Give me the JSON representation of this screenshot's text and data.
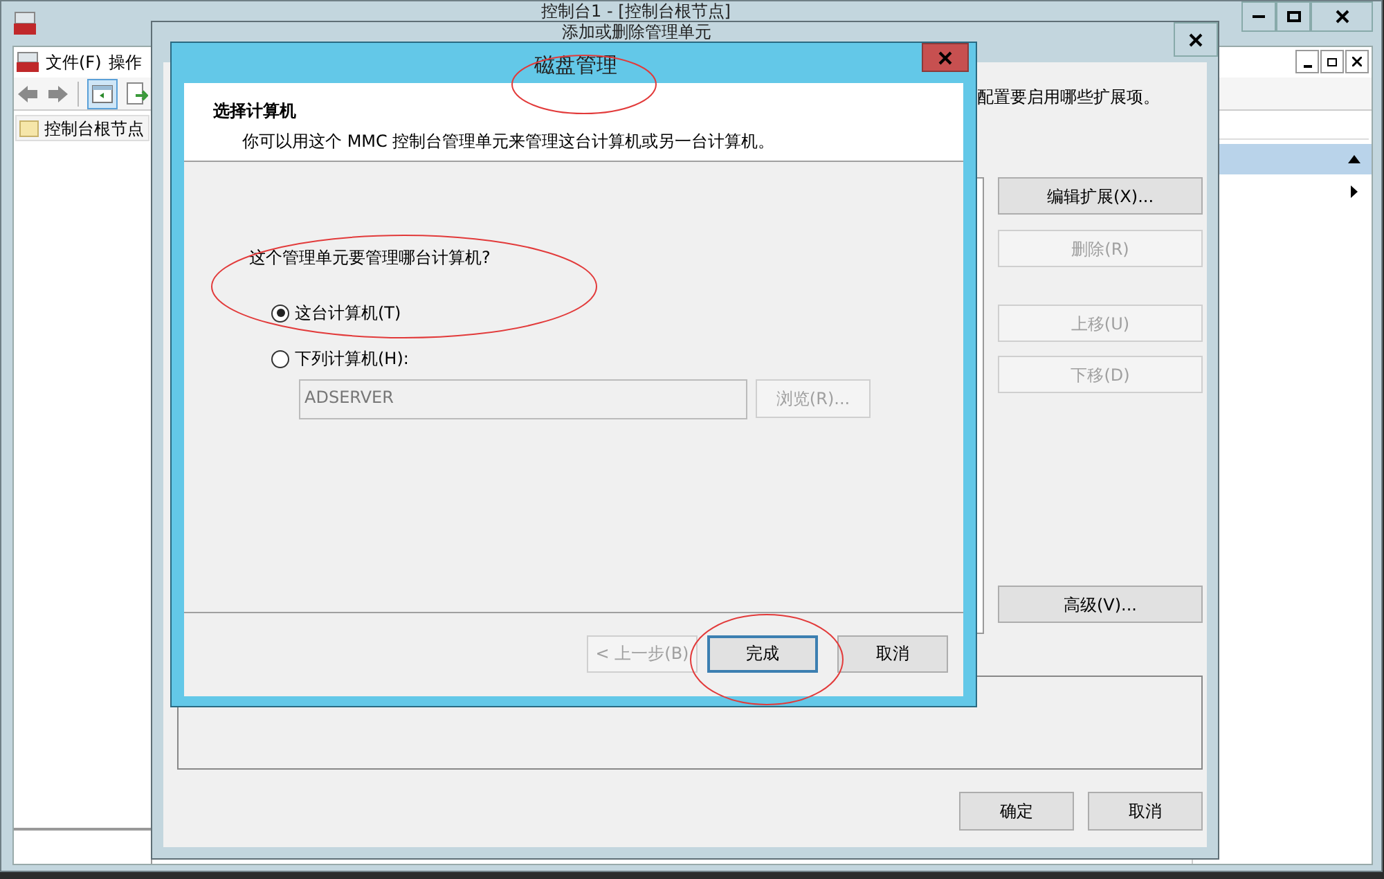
{
  "main_window": {
    "title": "控制台1 - [控制台根节点]",
    "menu": [
      {
        "label": "文件(F)"
      },
      {
        "label": "操作"
      }
    ],
    "tree": {
      "items": [
        {
          "label": "控制台根节点",
          "selected": false
        }
      ]
    }
  },
  "snapin_dialog": {
    "title": "添加或删除管理单元",
    "instruction": "配置要启用哪些扩展项。",
    "side_buttons": [
      {
        "label": "编辑扩展(X)...",
        "disabled": false
      },
      {
        "label": "删除(R)",
        "disabled": true
      },
      {
        "label": "上移(U)",
        "disabled": true
      },
      {
        "label": "下移(D)",
        "disabled": true
      },
      {
        "label": "高级(V)...",
        "disabled": false
      }
    ],
    "footer_buttons": [
      {
        "label": "确定",
        "disabled": false
      },
      {
        "label": "取消",
        "disabled": false
      }
    ]
  },
  "disk_dialog": {
    "title": "磁盘管理",
    "header_title": "选择计算机",
    "header_subtitle": "你可以用这个 MMC 控制台管理单元来管理这台计算机或另一台计算机。",
    "question": "这个管理单元要管理哪台计算机?",
    "options": [
      {
        "label": "这台计算机(T)",
        "selected": true
      },
      {
        "label": "下列计算机(H):",
        "selected": false
      }
    ],
    "computer_field": {
      "value": "ADSERVER",
      "disabled": true
    },
    "browse_button": {
      "label": "浏览(R)...",
      "disabled": true
    },
    "buttons": [
      {
        "label": "< 上一步(B)",
        "disabled": true,
        "default": false
      },
      {
        "label": "完成",
        "disabled": false,
        "default": true
      },
      {
        "label": "取消",
        "disabled": false,
        "default": false
      }
    ]
  }
}
